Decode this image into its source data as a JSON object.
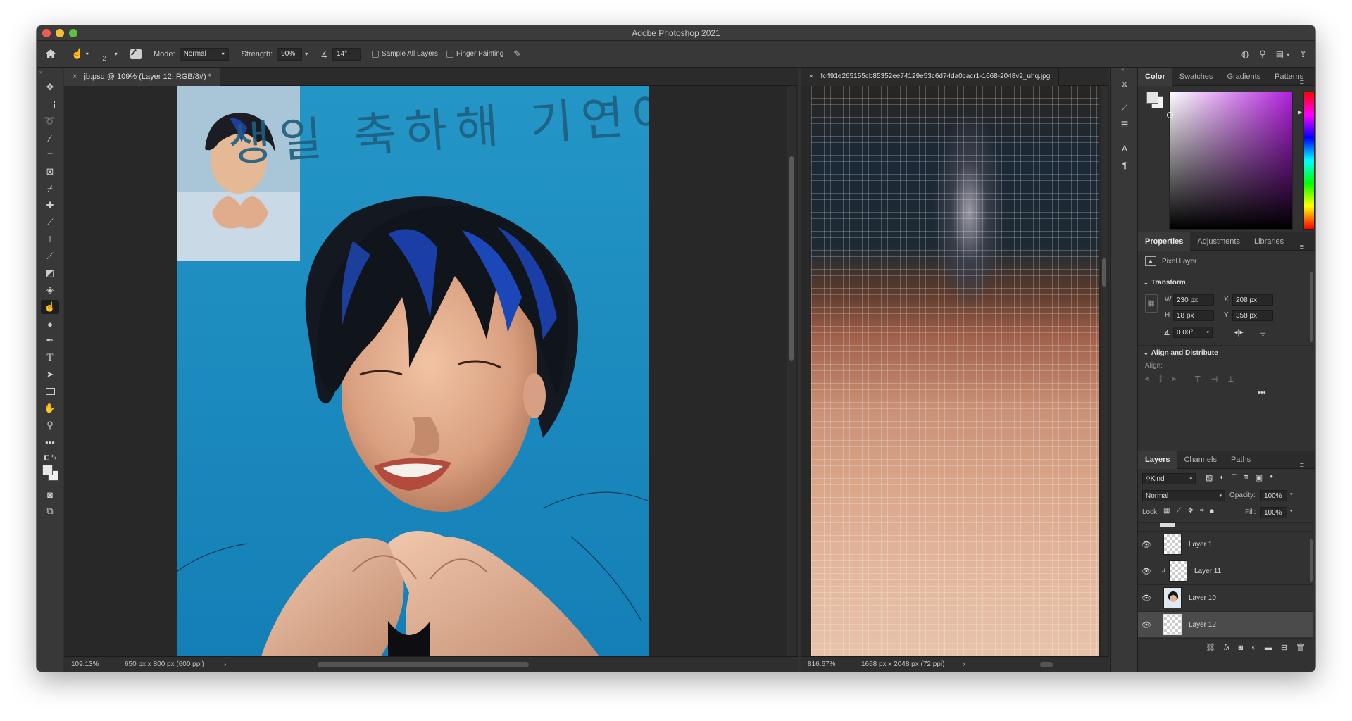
{
  "app": {
    "title": "Adobe Photoshop 2021"
  },
  "options_bar": {
    "mode_label": "Mode:",
    "mode_value": "Normal",
    "strength_label": "Strength:",
    "strength_value": "90%",
    "angle_value": "14°",
    "brush_size": "2",
    "sample_all_layers": "Sample All Layers",
    "finger_painting": "Finger Painting"
  },
  "doc_left": {
    "tab_title": "jb.psd @ 109% (Layer 12, RGB/8#) *",
    "zoom": "109.13%",
    "doc_info": "650 px x 800 px (600 ppi)",
    "caption_text": "생일 축하해 기연아"
  },
  "doc_right": {
    "tab_title": "fc491e265155cb85352ee74129e53c6d74da0cacr1-1668-2048v2_uhq.jpg",
    "zoom": "816.67%",
    "doc_info": "1668 px x 2048 px (72 ppi)"
  },
  "color_panel": {
    "tabs": [
      "Color",
      "Swatches",
      "Gradients",
      "Patterns"
    ],
    "active_tab": "Color"
  },
  "properties_panel": {
    "tabs": [
      "Properties",
      "Adjustments",
      "Libraries"
    ],
    "kind": "Pixel Layer",
    "transform_label": "Transform",
    "w_label": "W",
    "w_value": "230 px",
    "x_label": "X",
    "x_value": "208 px",
    "h_label": "H",
    "h_value": "18 px",
    "y_label": "Y",
    "y_value": "358 px",
    "angle_value": "0.00°",
    "align_distribute_label": "Align and Distribute",
    "align_label": "Align:"
  },
  "layers_panel": {
    "tabs": [
      "Layers",
      "Channels",
      "Paths"
    ],
    "filter_kind": "Kind",
    "blend_mode": "Normal",
    "opacity_label": "Opacity:",
    "opacity_value": "100%",
    "lock_label": "Lock:",
    "fill_label": "Fill:",
    "fill_value": "100%",
    "layers": [
      {
        "name": "Layer 1"
      },
      {
        "name": "Layer 11"
      },
      {
        "name": "Layer 10"
      },
      {
        "name": "Layer 12"
      }
    ]
  },
  "colors": {
    "canvas_blue": "#1a8dc0",
    "selected_layer": "#4b4b4b"
  }
}
